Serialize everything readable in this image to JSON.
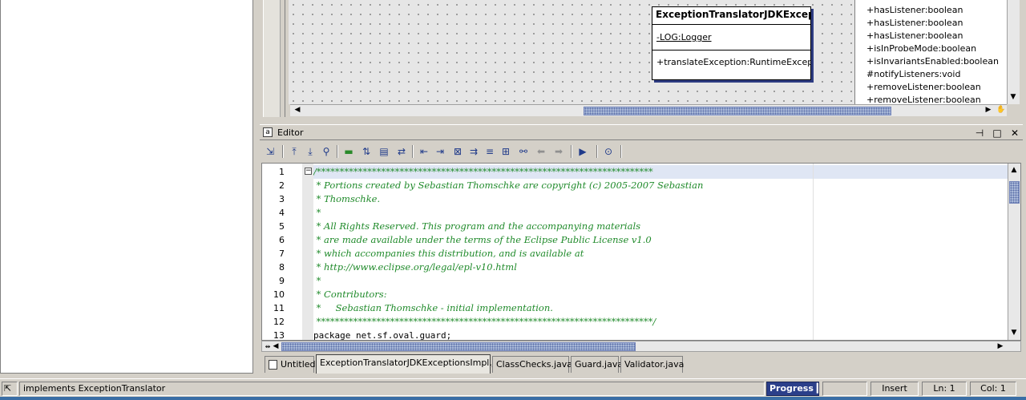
{
  "diagram": {
    "class_box": {
      "name": "ExceptionTranslatorJDKExcept...",
      "attribute": "-LOG:Logger",
      "operation": "+translateException:RuntimeExcep"
    },
    "members": [
      "+hasListener:boolean",
      "+hasListener:boolean",
      "+hasListener:boolean",
      "+isInProbeMode:boolean",
      "+isInvariantsEnabled:boolean",
      "#notifyListeners:void",
      "+removeListener:boolean",
      "+removeListener:boolean"
    ]
  },
  "editor": {
    "title": "Editor",
    "current_line": 1,
    "lines": [
      {
        "num": "1",
        "text": "/*************************************************************************",
        "kind": "comment"
      },
      {
        "num": "2",
        "text": " * Portions created by Sebastian Thomschke are copyright (c) 2005-2007 Sebastian",
        "kind": "comment"
      },
      {
        "num": "3",
        "text": " * Thomschke.",
        "kind": "comment"
      },
      {
        "num": "4",
        "text": " *",
        "kind": "comment"
      },
      {
        "num": "5",
        "text": " * All Rights Reserved. This program and the accompanying materials",
        "kind": "comment"
      },
      {
        "num": "6",
        "text": " * are made available under the terms of the Eclipse Public License v1.0",
        "kind": "comment"
      },
      {
        "num": "7",
        "text": " * which accompanies this distribution, and is available at",
        "kind": "comment"
      },
      {
        "num": "8",
        "text": " * http://www.eclipse.org/legal/epl-v10.html",
        "kind": "comment"
      },
      {
        "num": "9",
        "text": " *",
        "kind": "comment"
      },
      {
        "num": "10",
        "text": " * Contributors:",
        "kind": "comment"
      },
      {
        "num": "11",
        "text": " *     Sebastian Thomschke - initial implementation.",
        "kind": "comment"
      },
      {
        "num": "12",
        "text": " *************************************************************************/",
        "kind": "comment"
      },
      {
        "num": "13",
        "text": "package net.sf.oval.guard;",
        "kind": "code"
      }
    ]
  },
  "tabs": [
    "Untitled",
    "ExceptionTranslatorJDKExceptionsImpl.java",
    "ClassChecks.java",
    "Guard.java",
    "Validator.java"
  ],
  "status": {
    "message": "implements ExceptionTranslator",
    "progress_label": "Progress",
    "mode": "Insert",
    "line": "Ln: 1",
    "col": "Col: 1"
  },
  "colors": {
    "comment": "#1f8a2a",
    "current_line": "#dfe6f4",
    "scroll_thumb": "#a8b8d8",
    "progress_bg": "#2b3f8a"
  }
}
